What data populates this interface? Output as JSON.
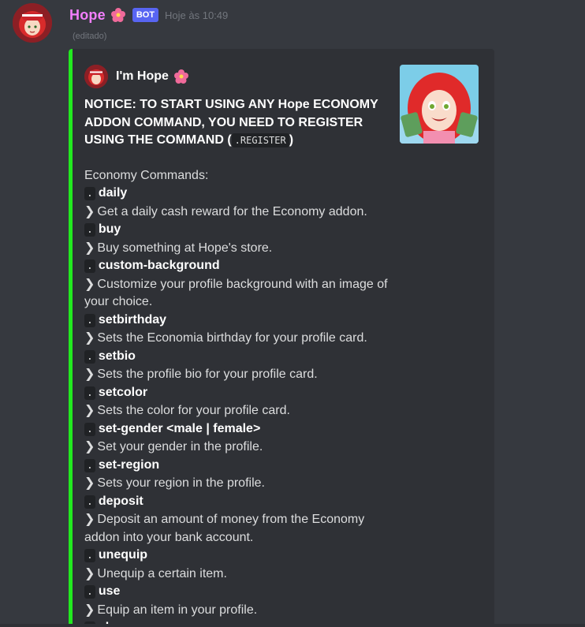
{
  "message": {
    "username": "Hope",
    "bot_tag": "BOT",
    "timestamp": "Hoje às 10:49",
    "edited_label": "(editado)",
    "flower_icon": "hibiscus-emoji"
  },
  "embed": {
    "accent_color": "#22e91f",
    "author_name": "I'm Hope",
    "notice_text": "NOTICE: TO START USING ANY Hope ECONOMY ADDON COMMAND, YOU NEED TO REGISTER USING THE COMMAND (",
    "notice_code": ".REGISTER",
    "notice_end": ")",
    "section_title": "Economy Commands:",
    "commands": [
      {
        "prefix": ".",
        "name": "daily",
        "desc": "Get a daily cash reward for the Economy addon."
      },
      {
        "prefix": ".",
        "name": "buy",
        "desc": "Buy something at Hope's store."
      },
      {
        "prefix": ".",
        "name": "custom-background",
        "desc": "Customize your profile background with an image of your choice."
      },
      {
        "prefix": ".",
        "name": "setbirthday",
        "desc": "Sets the Economia birthday for your profile card."
      },
      {
        "prefix": ".",
        "name": "setbio",
        "desc": "Sets the profile bio for your profile card."
      },
      {
        "prefix": ".",
        "name": "setcolor",
        "desc": "Sets the color for your profile card."
      },
      {
        "prefix": ".",
        "name": "set-gender <male | female>",
        "desc": "Set your gender in the profile."
      },
      {
        "prefix": ".",
        "name": "set-region",
        "desc": "Sets your region in the profile."
      },
      {
        "prefix": ".",
        "name": "deposit",
        "desc": "Deposit an amount of money from the Economy addon into your bank account."
      },
      {
        "prefix": ".",
        "name": "unequip",
        "desc": "Unequip a certain item."
      },
      {
        "prefix": ".",
        "name": "use",
        "desc": "Equip an item in your profile."
      },
      {
        "prefix": ".",
        "name": "alms",
        "desc": ""
      }
    ]
  }
}
